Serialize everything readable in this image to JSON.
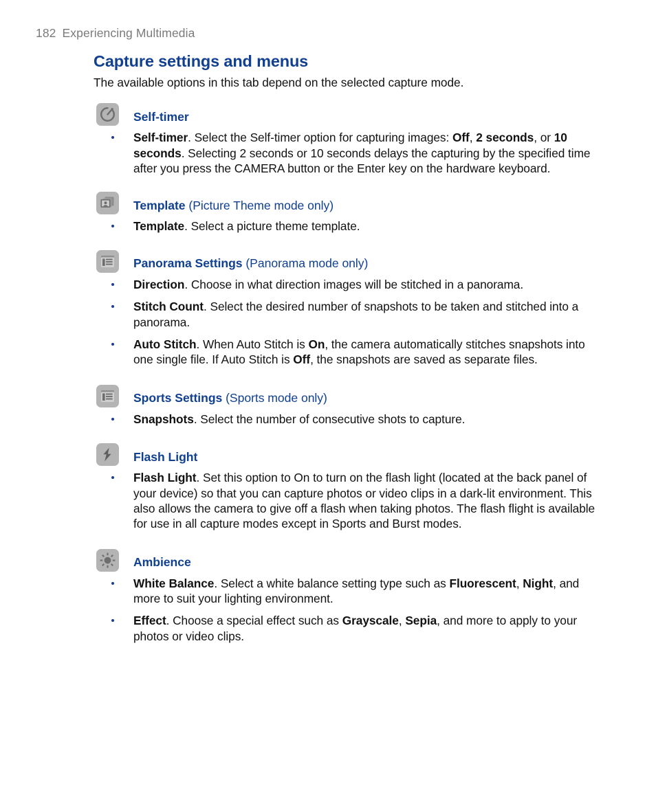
{
  "header": {
    "page_number": "182",
    "chapter_title": "Experiencing Multimedia"
  },
  "section": {
    "title": "Capture settings and menus",
    "intro": "The available options in this tab depend on the selected capture mode."
  },
  "blocks": [
    {
      "icon": "self-timer-icon",
      "heading": "Self-timer",
      "heading_note": "",
      "bullets": [
        {
          "term": "Self-timer",
          "text_1": ". Select the Self-timer option for capturing images: ",
          "bold_1": "Off",
          "text_2": ", ",
          "bold_2": "2 seconds",
          "text_3": ", or ",
          "bold_3": "10 seconds",
          "text_4": ". Selecting 2 seconds or 10 seconds delays the capturing by the specified time after you press the CAMERA button or the Enter key on the hardware keyboard."
        }
      ]
    },
    {
      "icon": "template-icon",
      "heading": "Template",
      "heading_note": "(Picture Theme mode only)",
      "bullets": [
        {
          "term": "Template",
          "text_1": ". Select a picture theme template."
        }
      ]
    },
    {
      "icon": "panorama-settings-icon",
      "heading": "Panorama Settings",
      "heading_note": "(Panorama mode only)",
      "bullets": [
        {
          "term": "Direction",
          "text_1": ". Choose in what direction images will be stitched in a panorama."
        },
        {
          "term": "Stitch Count",
          "text_1": ". Select the desired number of snapshots to be taken and stitched into a panorama."
        },
        {
          "term": "Auto Stitch",
          "text_1": ". When Auto Stitch is ",
          "bold_1": "On",
          "text_2": ", the camera automatically stitches snapshots into one single file. If Auto Stitch is ",
          "bold_2": "Off",
          "text_3": ", the snapshots are saved as separate files."
        }
      ]
    },
    {
      "icon": "sports-settings-icon",
      "heading": "Sports Settings",
      "heading_note": "(Sports mode only)",
      "bullets": [
        {
          "term": "Snapshots",
          "text_1": ". Select the number of consecutive shots to capture."
        }
      ]
    },
    {
      "icon": "flash-light-icon",
      "heading": "Flash Light",
      "heading_note": "",
      "bullets": [
        {
          "term": "Flash Light",
          "text_1": ". Set this option to On to turn on the flash light (located at the back panel of your device) so that you can capture photos or video clips in a dark-lit environment. This also allows the camera to give off a flash when taking photos. The flash flight is available for use in all capture modes except in Sports and Burst modes."
        }
      ]
    },
    {
      "icon": "ambience-icon",
      "heading": "Ambience",
      "heading_note": "",
      "bullets": [
        {
          "term": "White Balance",
          "text_1": ". Select a white balance setting type such as ",
          "bold_1": "Fluorescent",
          "text_2": ", ",
          "bold_2": "Night",
          "text_3": ", and more to suit your lighting environment."
        },
        {
          "term": "Effect",
          "text_1": ". Choose a special effect such as ",
          "bold_1": "Grayscale",
          "text_2": ", ",
          "bold_2": "Sepia",
          "text_3": ", and more to apply to your photos or video clips."
        }
      ]
    }
  ],
  "colors": {
    "heading_blue": "#10408f",
    "body_text": "#121212",
    "running_head_gray": "#7a7a7a",
    "icon_badge_gray": "#b4b4b4",
    "icon_glyph_gray": "#6e6e6e",
    "bullet_navy": "#1b3f8f"
  }
}
